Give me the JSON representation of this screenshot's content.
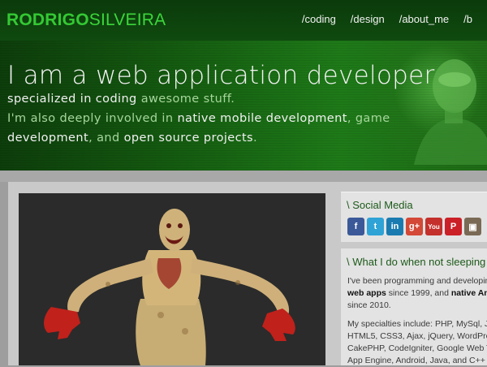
{
  "header": {
    "logo_bold": "RODRIGO",
    "logo_light": "SILVEIRA",
    "nav": [
      {
        "label": "/coding"
      },
      {
        "label": "/design"
      },
      {
        "label": "/about_me"
      },
      {
        "label": "/b"
      }
    ]
  },
  "hero": {
    "title": "I am a web application developer",
    "line1_a": "specialized in coding ",
    "line1_b": "awesome stuff.",
    "line2_a": "I'm also deeply involved in ",
    "line2_b": "native mobile development",
    "line2_c": ", game",
    "line3_a": "development",
    "line3_b": ", and ",
    "line3_c": "open source projects",
    "line3_d": "."
  },
  "sidebar": {
    "social_title": "\\ Social Media",
    "social_icons": [
      {
        "name": "facebook-icon",
        "glyph": "f",
        "color": "#3b5998"
      },
      {
        "name": "twitter-icon",
        "glyph": "t",
        "color": "#2fa3d6"
      },
      {
        "name": "linkedin-icon",
        "glyph": "in",
        "color": "#1a7bb0"
      },
      {
        "name": "googleplus-icon",
        "glyph": "g+",
        "color": "#d34836"
      },
      {
        "name": "youtube-icon",
        "glyph": "You",
        "color": "#c4302b"
      },
      {
        "name": "pinterest-icon",
        "glyph": "P",
        "color": "#cb2027"
      },
      {
        "name": "instagram-icon",
        "glyph": "▣",
        "color": "#7a6a55"
      }
    ],
    "sleeping_title": "\\ What I do when not sleeping",
    "para1_line1": "I've been programming and developing",
    "para1_line2_b": "web apps",
    "para1_line2_c": " since 1999, and ",
    "para1_line2_d": "native And",
    "para1_line3": "since 2010.",
    "para2_line1": "My specialties include: PHP, MySql, Ja",
    "para2_line2": "HTML5, CSS3, Ajax, jQuery, WordPre",
    "para2_line3": "CakePHP, CodeIgniter, Google Web T",
    "para2_line4": "App Engine, Android, Java, and C++"
  },
  "colors": {
    "header_bg": "#0f4a0f",
    "hero_accent": "#1e7a18",
    "logo_green": "#34c934",
    "sidebar_title_green": "#1d5a1a"
  }
}
